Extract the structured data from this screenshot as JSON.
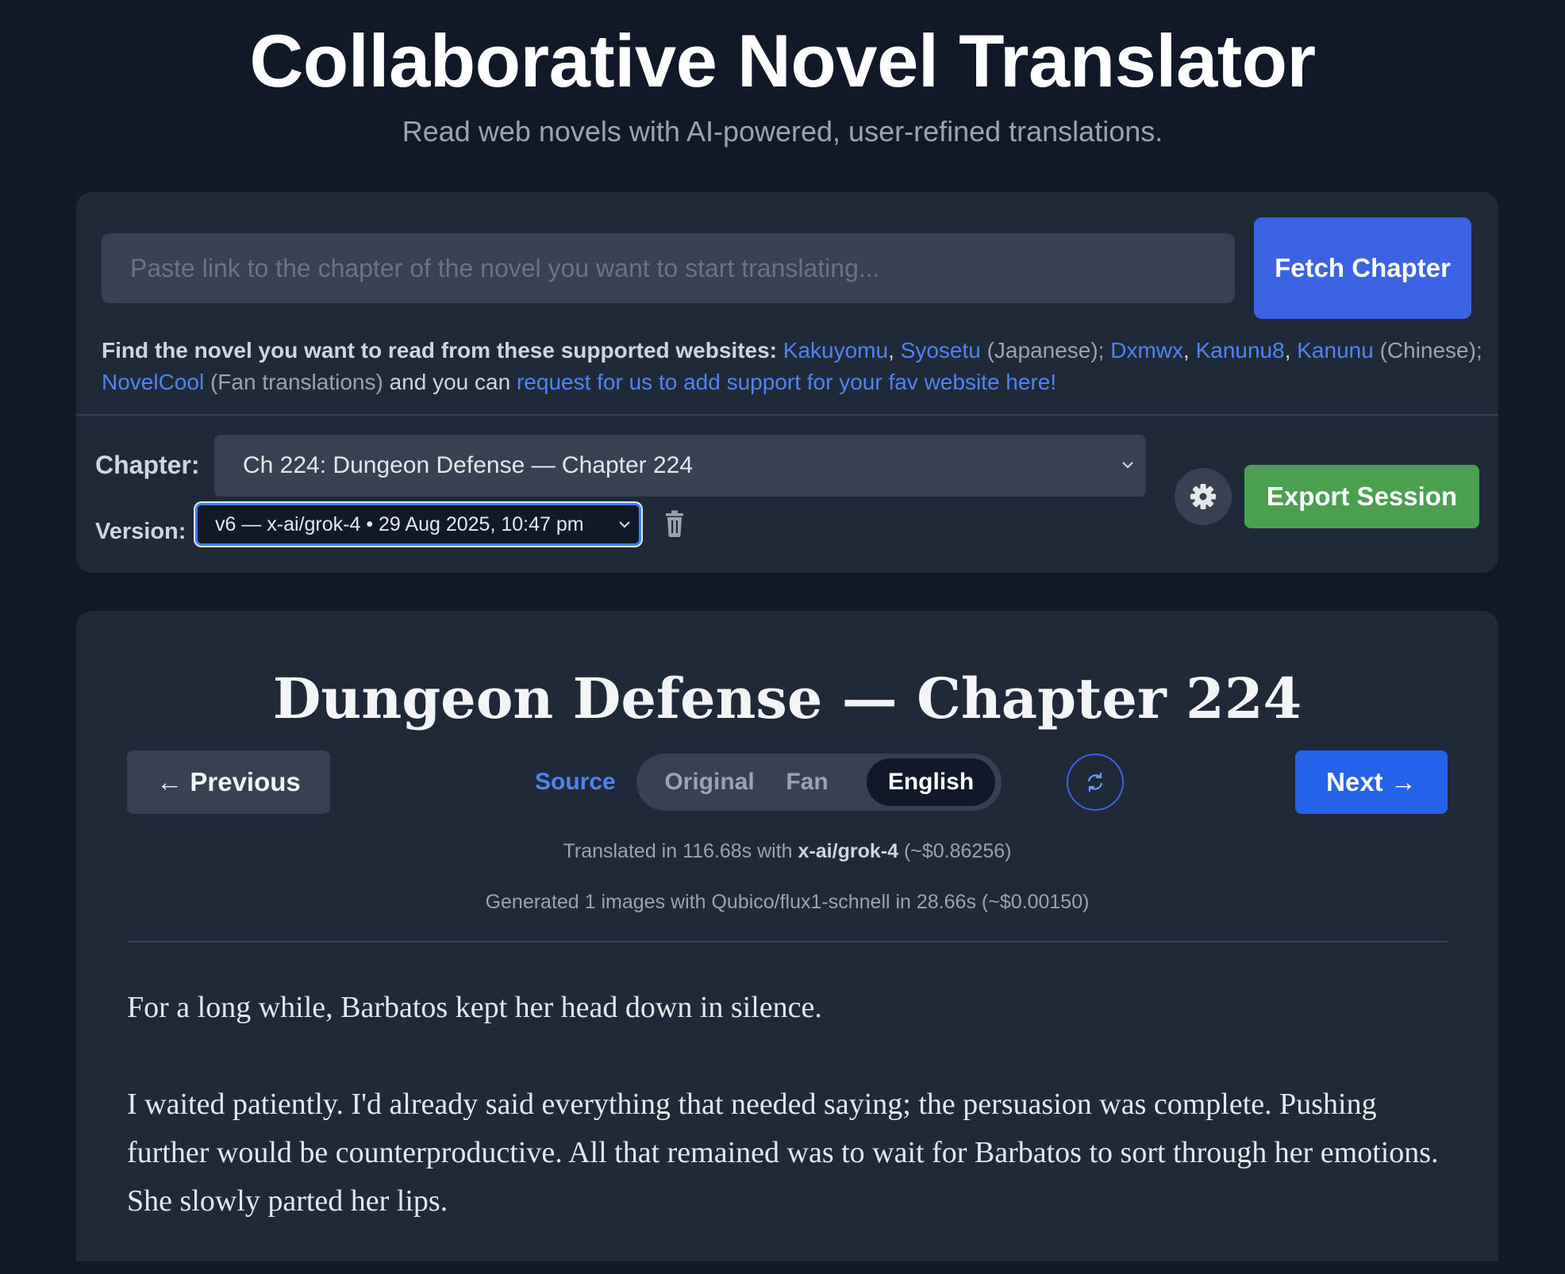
{
  "header": {
    "title": "Collaborative Novel Translator",
    "subtitle": "Read web novels with AI-powered, user-refined translations."
  },
  "fetch": {
    "placeholder": "Paste link to the chapter of the novel you want to start translating...",
    "button_label": "Fetch Chapter"
  },
  "supported": {
    "lead": "Find the novel you want to read from these supported websites:",
    "kakuyomu": "Kakuyomu",
    "syosetu": "Syosetu",
    "japanese": "(Japanese);",
    "dxmwx": "Dxmwx",
    "kanunu8": "Kanunu8",
    "kanunu": "Kanunu",
    "chinese": "(Chinese);",
    "novelcool": "NovelCool",
    "fan": "(Fan translations)",
    "and_text": "and you can",
    "request_link": "request for us to add support for your fav website here!"
  },
  "controls": {
    "chapter_label": "Chapter:",
    "chapter_value": "Ch 224: Dungeon Defense — Chapter 224",
    "version_label": "Version:",
    "version_value": "v6 — x-ai/grok-4 • 29 Aug 2025, 10:47 pm",
    "export_label": "Export Session"
  },
  "reader": {
    "heading": "Dungeon Defense — Chapter 224",
    "prev_label": "← Previous",
    "next_label": "Next →",
    "source_label": "Source",
    "modes": {
      "original": "Original",
      "fan": "Fan",
      "english": "English",
      "selected": "English"
    },
    "meta": {
      "translated_prefix": "Translated in 116.68s with",
      "translated_model": "x-ai/grok-4",
      "translated_cost": "(~$0.86256)",
      "generated": "Generated 1 images with Qubico/flux1-schnell in 28.66s (~$0.00150)"
    },
    "paragraphs": [
      "For a long while, Barbatos kept her head down in silence.",
      "I waited patiently. I'd already said everything that needed saying; the persuasion was complete. Pushing further would be counterproductive. All that remained was to wait for Barbatos to sort through her emotions. She slowly parted her lips."
    ]
  },
  "colors": {
    "background": "#111827",
    "panel": "#1f2937",
    "accent_blue": "#3b63e4",
    "link_blue": "#4f83f7",
    "export_green": "#4ba050"
  },
  "icons": {
    "trash": "trash-icon",
    "settings": "gear-icon",
    "refresh": "refresh-icon",
    "chevron": "chevron-down-icon"
  }
}
